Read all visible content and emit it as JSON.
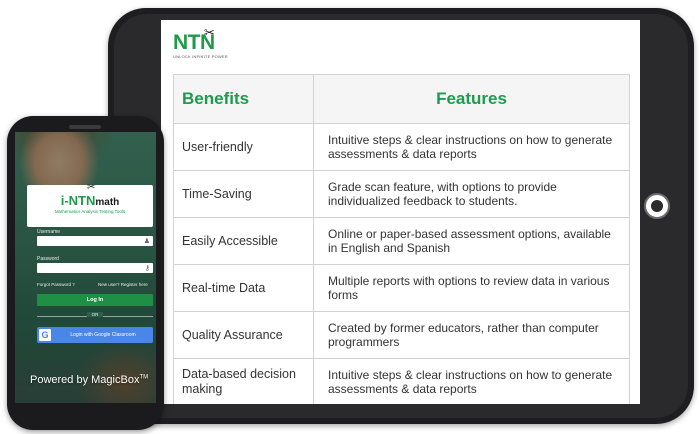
{
  "tablet": {
    "brand": {
      "logo_text": "NTN",
      "tagline": "UNLOCK INFINITE POWER"
    },
    "table": {
      "headers": [
        "Benefits",
        "Features"
      ],
      "rows": [
        {
          "benefit": "User-friendly",
          "feature": "Intuitive steps & clear instructions on how to generate assessments & data reports"
        },
        {
          "benefit": "Time-Saving",
          "feature": "Grade scan feature, with options to provide individualized feedback to students."
        },
        {
          "benefit": "Easily Accessible",
          "feature": "Online or paper-based assessment options, available in English and Spanish"
        },
        {
          "benefit": "Real-time Data",
          "feature": "Multiple reports with options to review data in various forms"
        },
        {
          "benefit": "Quality Assurance",
          "feature": "Created by former educators, rather than computer programmers"
        },
        {
          "benefit": "Data-based decision making",
          "feature": "Intuitive steps & clear instructions on how to generate assessments & data reports"
        }
      ]
    }
  },
  "phone": {
    "app_logo": {
      "prefix": "i-NTN",
      "suffix": "math",
      "subtitle": "Mathematics Analysis Testing Tools"
    },
    "username_label": "Username",
    "password_label": "Password",
    "forgot_password": "Forgot Password ?",
    "register": "New user? Register here",
    "login_button": "Log In",
    "or_text": "OR",
    "google_button": "Login with Google Classroom",
    "powered_by": "Powered by MagicBox",
    "trademark": "TM"
  },
  "colors": {
    "brand_green": "#1f9a4a",
    "google_blue": "#4a86e8",
    "device_frame": "#1e1e20"
  }
}
